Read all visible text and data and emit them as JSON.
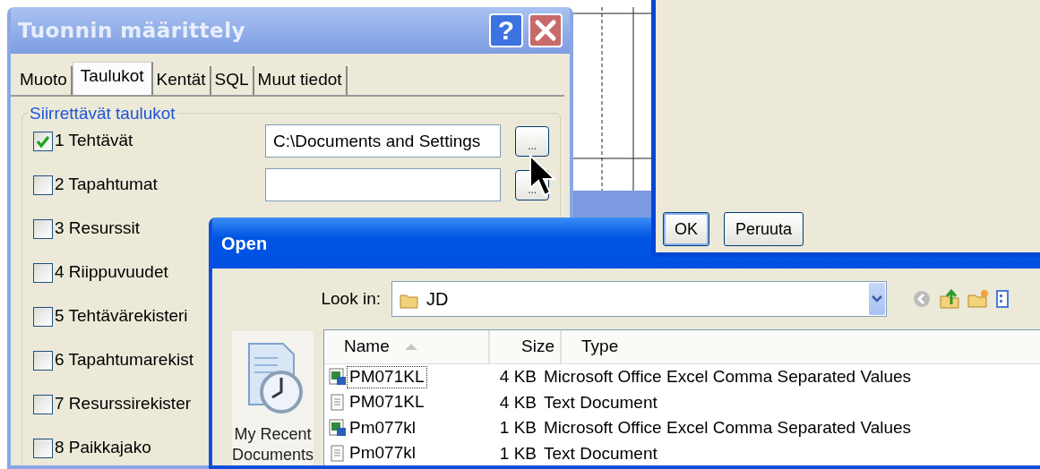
{
  "import_dialog": {
    "title": "Tuonnin määrittely",
    "help_button": "?",
    "tabs": [
      {
        "label": "Muoto",
        "selected": false
      },
      {
        "label": "Taulukot",
        "selected": true
      },
      {
        "label": "Kentät",
        "selected": false
      },
      {
        "label": "SQL",
        "selected": false
      },
      {
        "label": "Muut tiedot",
        "selected": false
      }
    ],
    "group_title": "Siirrettävät taulukot",
    "tables": [
      {
        "label": "1 Tehtävät",
        "checked": true
      },
      {
        "label": "2 Tapahtumat",
        "checked": false
      },
      {
        "label": "3 Resurssit",
        "checked": false
      },
      {
        "label": "4 Riippuvuudet",
        "checked": false
      },
      {
        "label": "5 Tehtävärekisteri",
        "checked": false
      },
      {
        "label": "6 Tapahtumarekist",
        "checked": false
      },
      {
        "label": "7 Resurssirekister",
        "checked": false
      },
      {
        "label": "8 Paikkajako",
        "checked": false
      }
    ],
    "file_fields": [
      {
        "kind": "filled",
        "value": "C:\\Documents and Settings",
        "browse": "..."
      },
      {
        "kind": "empty",
        "browse": "..."
      }
    ]
  },
  "back_dialog": {
    "buttons": [
      {
        "label": "OK",
        "default": true
      },
      {
        "label": "Peruuta",
        "default": false
      }
    ]
  },
  "open_dialog": {
    "title": "Open",
    "look_in_label": "Look in:",
    "look_in_value": "JD",
    "places": [
      {
        "label": "My Recent Documents"
      }
    ],
    "columns": [
      {
        "label": "Name",
        "sorted": true
      },
      {
        "label": "Size",
        "sorted": false
      },
      {
        "label": "Type",
        "sorted": false
      }
    ],
    "files": [
      {
        "name": "PM071KL",
        "size": "4 KB",
        "type": "Microsoft Office Excel Comma Separated Values",
        "kind": "csv",
        "selected": true
      },
      {
        "name": "PM071KL",
        "size": "4 KB",
        "type": "Text Document",
        "kind": "text",
        "selected": false
      },
      {
        "name": "Pm077kl",
        "size": "1 KB",
        "type": "Microsoft Office Excel Comma Separated Values",
        "kind": "csv",
        "selected": false
      },
      {
        "name": "Pm077kl",
        "size": "1 KB",
        "type": "Text Document",
        "kind": "text",
        "selected": false
      }
    ]
  }
}
